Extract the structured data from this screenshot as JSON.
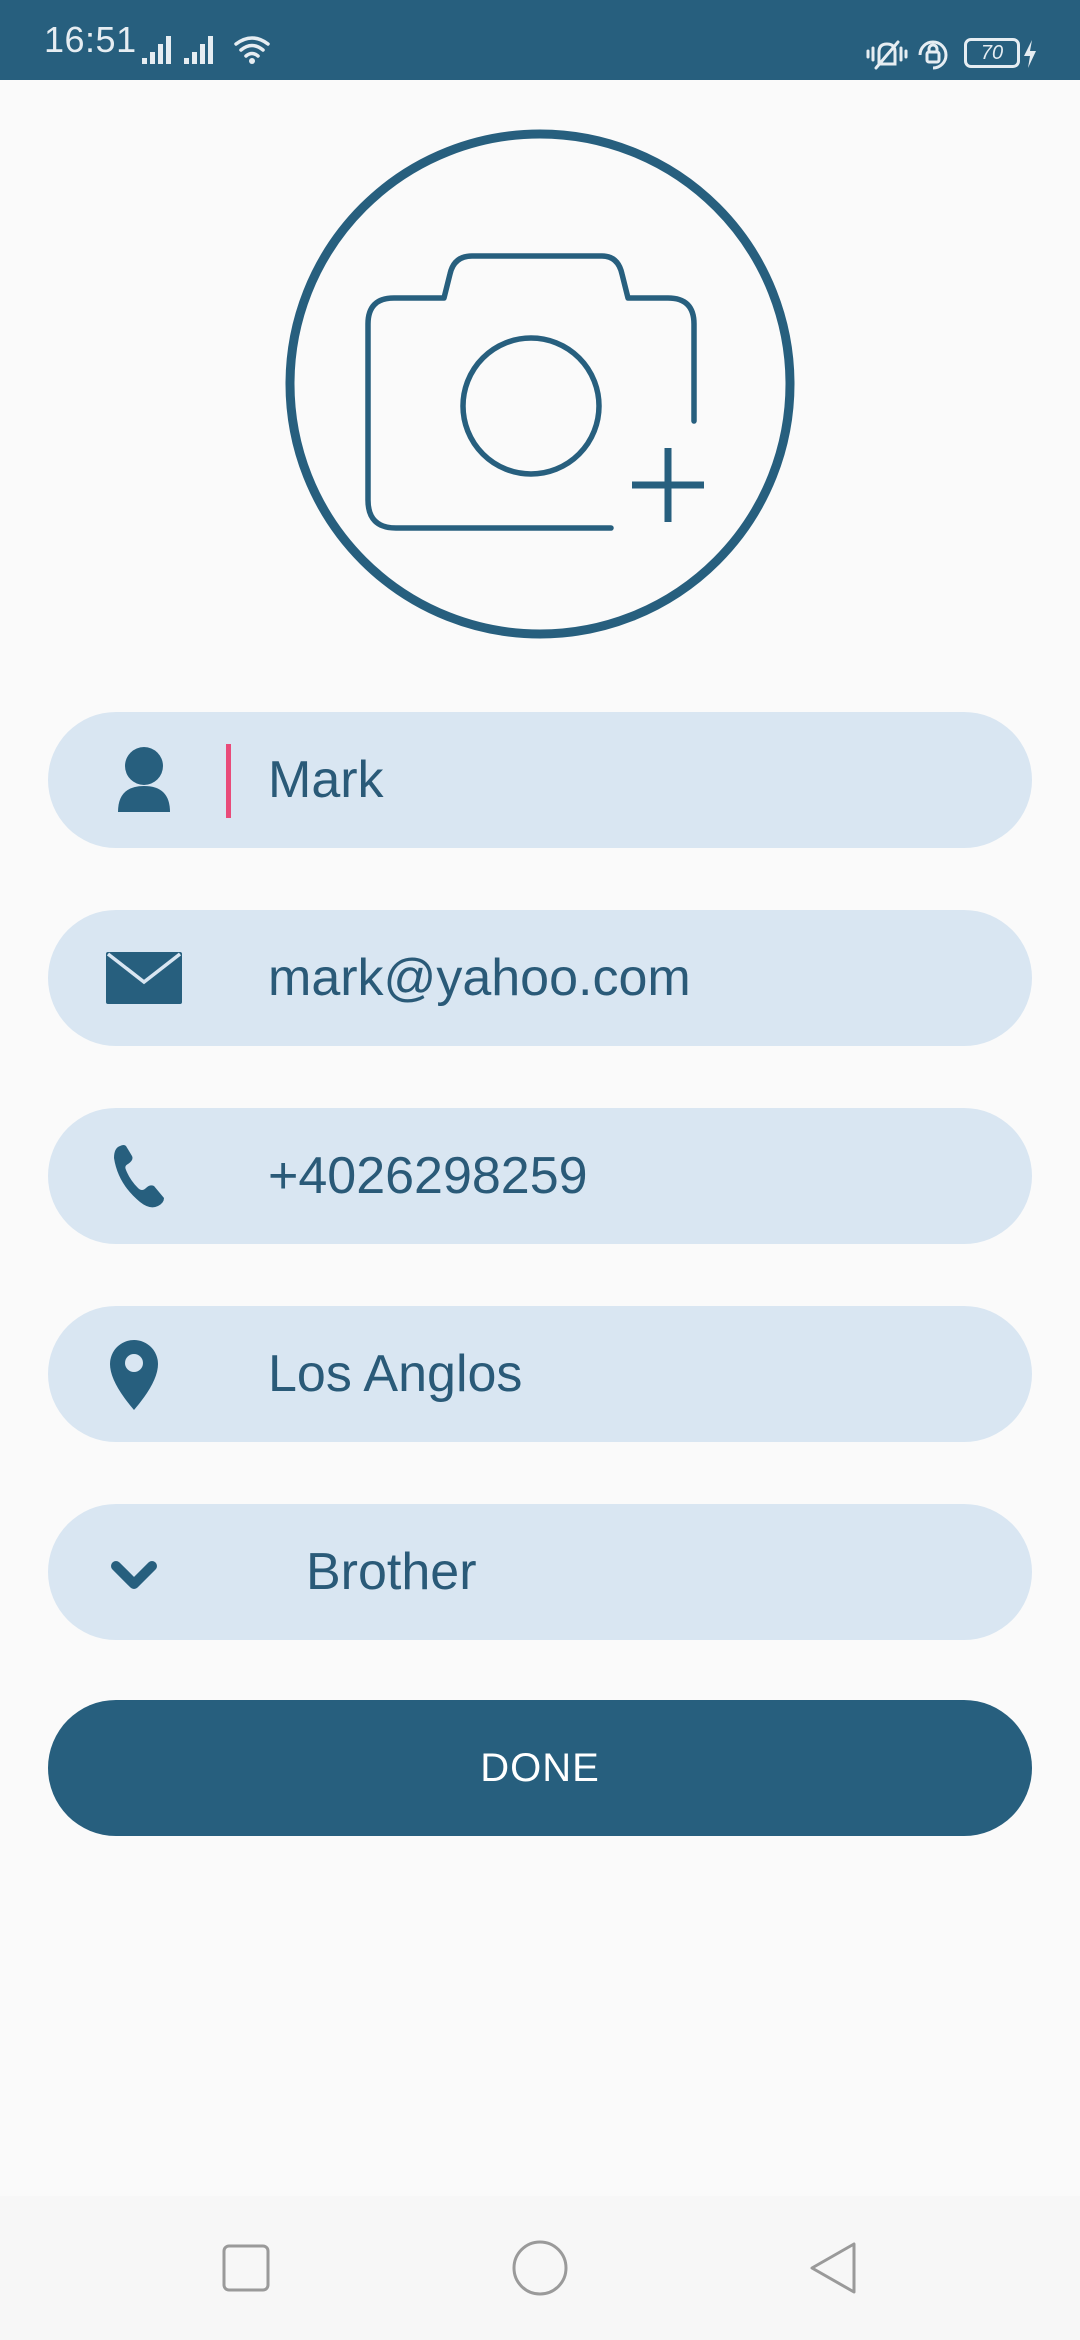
{
  "status_bar": {
    "time": "16:51",
    "battery": "70",
    "icons": [
      "signal-icon",
      "signal-icon",
      "wifi-icon",
      "vibrate-icon",
      "rotation-lock-icon",
      "battery-icon",
      "charging-icon"
    ]
  },
  "avatar": {
    "icon": "add-photo-camera-icon"
  },
  "form": {
    "name": {
      "value": "Mark",
      "icon": "person-icon"
    },
    "email": {
      "value": "mark@yahoo.com",
      "icon": "mail-icon"
    },
    "phone": {
      "value": "+4026298259",
      "icon": "phone-icon"
    },
    "location": {
      "value": "Los Anglos",
      "icon": "location-pin-icon"
    },
    "relation": {
      "value": "Brother",
      "icon": "chevron-down-icon"
    }
  },
  "done_button": {
    "label": "DONE"
  },
  "nav_bar": {
    "recents": "square-icon",
    "home": "circle-icon",
    "back": "triangle-back-icon"
  },
  "colors": {
    "primary": "#275f7e",
    "field_bg": "#d9e6f2",
    "text": "#2a5a78",
    "caret": "#e94b7a",
    "background": "#fafafa"
  }
}
